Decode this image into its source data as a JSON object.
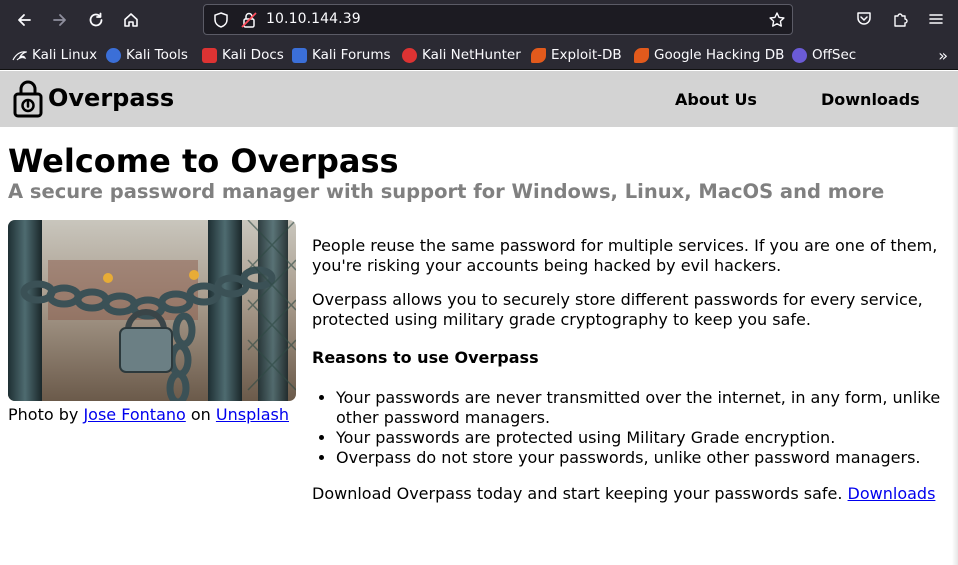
{
  "browser": {
    "url": "10.10.144.39",
    "bookmarks": [
      {
        "label": "Kali Linux",
        "color": "#1f1f1f"
      },
      {
        "label": "Kali Tools",
        "color": "#3b6fd8"
      },
      {
        "label": "Kali Docs",
        "color": "#d33"
      },
      {
        "label": "Kali Forums",
        "color": "#3b6fd8"
      },
      {
        "label": "Kali NetHunter",
        "color": "#d33"
      },
      {
        "label": "Exploit-DB",
        "color": "#e25a1c"
      },
      {
        "label": "Google Hacking DB",
        "color": "#e25a1c"
      },
      {
        "label": "OffSec",
        "color": "#6b5bd6"
      }
    ]
  },
  "header": {
    "logo_text": "Overpass",
    "nav": [
      {
        "label": "About Us"
      },
      {
        "label": "Downloads"
      }
    ]
  },
  "main": {
    "title": "Welcome to Overpass",
    "subtitle": "A secure password manager with support for Windows, Linux, MacOS and more",
    "photo_credit": {
      "prefix": "Photo by",
      "author": "Jose Fontano",
      "middle": "on",
      "site": "Unsplash"
    },
    "paragraph1": "People reuse the same password for multiple services. If you are one of them, you're risking your accounts being hacked by evil hackers.",
    "paragraph2": "Overpass allows you to securely store different passwords for every service, protected using military grade cryptography to keep you safe.",
    "reasons_heading": "Reasons to use Overpass",
    "reasons": [
      "Your passwords are never transmitted over the internet, in any form, unlike other password managers.",
      "Your passwords are protected using Military Grade encryption.",
      "Overpass do not store your passwords, unlike other password managers."
    ],
    "download_text": "Download Overpass today and start keeping your passwords safe.",
    "download_link": "Downloads"
  }
}
